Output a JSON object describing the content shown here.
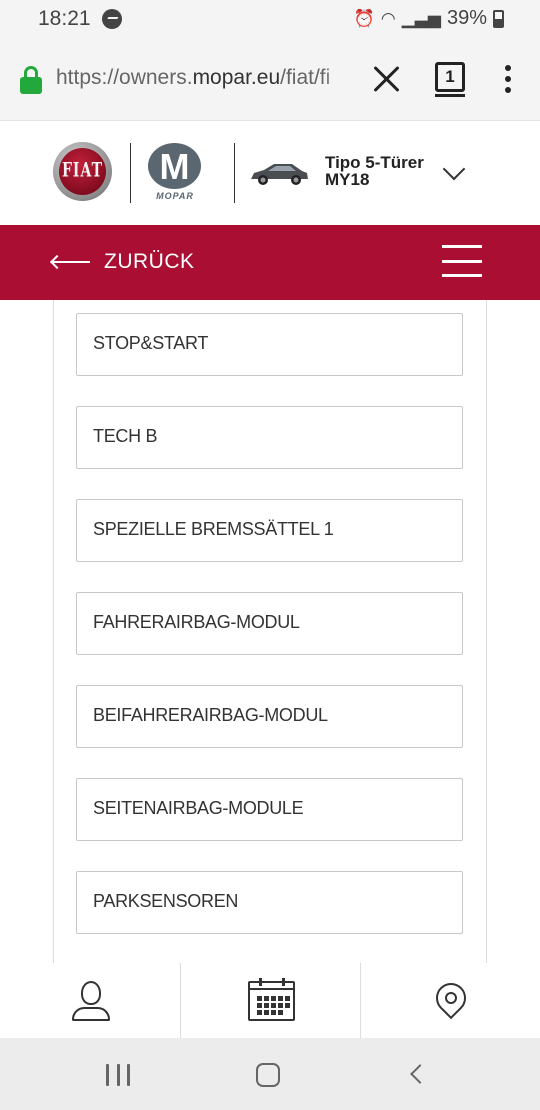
{
  "status_bar": {
    "time": "18:21",
    "battery": "39%",
    "icons": [
      "messenger-icon",
      "alarm-icon",
      "wifi-icon",
      "signal-icon",
      "battery-icon"
    ]
  },
  "browser": {
    "url_prefix": "https://owners.",
    "url_host": "mopar.eu",
    "url_path": "/fiat/fi",
    "tab_count": "1",
    "progress": 0.8,
    "colors": {
      "lock": "#23a83c",
      "progress": "#1ea6e8"
    }
  },
  "header": {
    "brand_logo_text": "FIAT",
    "partner_logo_text": "MOPAR",
    "model_name": "Tipo 5-Türer",
    "model_year": "MY18"
  },
  "nav": {
    "back_label": "ZURÜCK",
    "color": "#aa0e32"
  },
  "menu_items": [
    "STOP&START",
    "TECH B",
    "SPEZIELLE BREMSSÄTTEL 1",
    "FAHRERAIRBAG-MODUL",
    "BEIFAHRERAIRBAG-MODUL",
    "SEITENAIRBAG-MODULE",
    "PARKSENSOREN"
  ],
  "bottom_tabs": [
    {
      "icon": "user-icon"
    },
    {
      "icon": "calendar-icon"
    },
    {
      "icon": "location-pin-icon"
    }
  ],
  "system_nav": [
    "recent-apps-icon",
    "home-icon",
    "back-icon"
  ]
}
